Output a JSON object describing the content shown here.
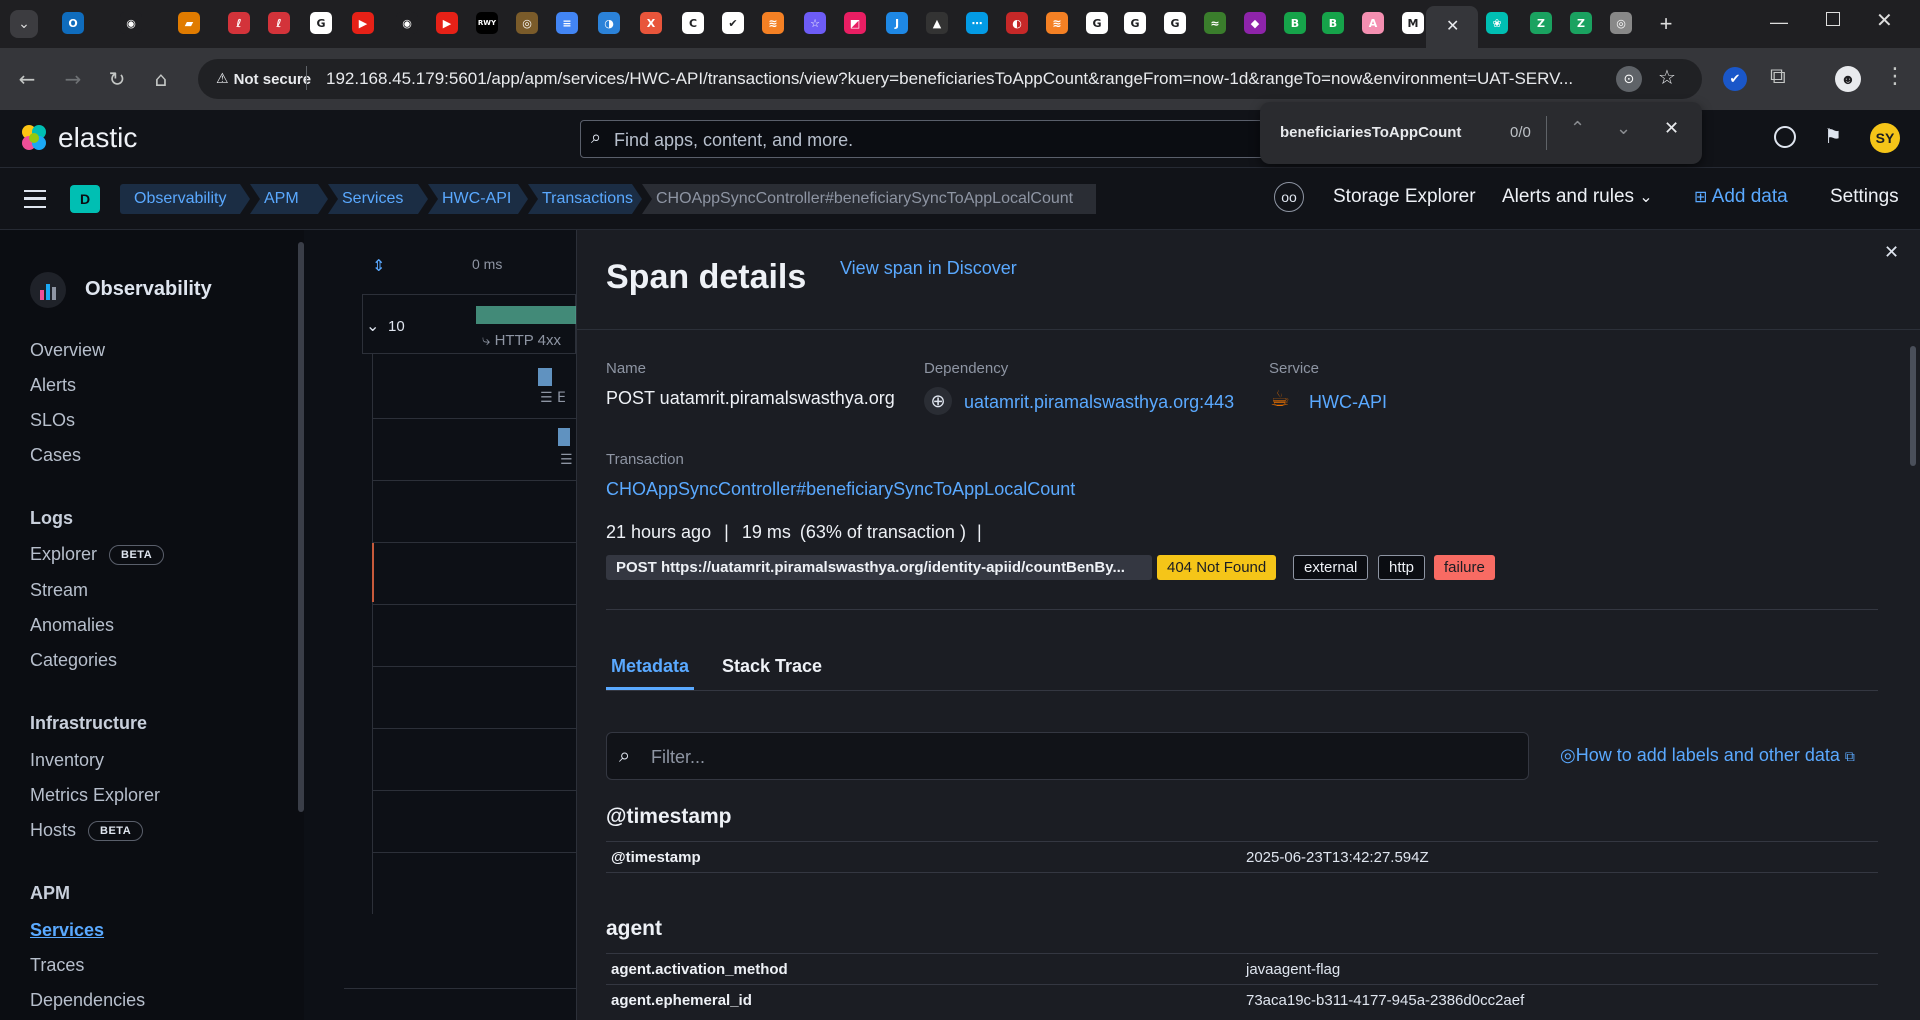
{
  "browser": {
    "find_bar": {
      "query": "beneficiariesToAppCount",
      "count": "0/0"
    },
    "address": {
      "security_label": "Not secure",
      "url": "192.168.45.179:5601/app/apm/services/HWC-API/transactions/view?kuery=beneficiariesToAppCount&rangeFrom=now-1d&rangeTo=now&environment=UAT-SERV..."
    },
    "tabs": [
      {
        "icon": "outlook-icon",
        "color": "#0f6cbd",
        "glyph": "O"
      },
      {
        "icon": "github-icon",
        "color": "#1f1f22",
        "glyph": "◉"
      },
      {
        "icon": "folder-icon",
        "color": "#e07b00",
        "glyph": "▰"
      },
      {
        "icon": "app-icon",
        "color": "#d3333a",
        "glyph": "ℓ"
      },
      {
        "icon": "app-icon",
        "color": "#d3333a",
        "glyph": "ℓ"
      },
      {
        "icon": "google-icon",
        "color": "#ffffff",
        "glyph": "G"
      },
      {
        "icon": "youtube-icon",
        "color": "#e62117",
        "glyph": "▶"
      },
      {
        "icon": "github-icon",
        "color": "#1f1f22",
        "glyph": "◉"
      },
      {
        "icon": "youtube-icon",
        "color": "#e62117",
        "glyph": "▶"
      },
      {
        "icon": "rwy-icon",
        "color": "#000000",
        "glyph": "RWY"
      },
      {
        "icon": "app-icon",
        "color": "#7a5b2a",
        "glyph": "◎"
      },
      {
        "icon": "docs-icon",
        "color": "#4285f4",
        "glyph": "≡"
      },
      {
        "icon": "app-icon",
        "color": "#2b82d9",
        "glyph": "◑"
      },
      {
        "icon": "app-icon",
        "color": "#e8553b",
        "glyph": "X"
      },
      {
        "icon": "app-icon",
        "color": "#ffffff",
        "glyph": "C"
      },
      {
        "icon": "app-icon",
        "color": "#ffffff",
        "glyph": "✔"
      },
      {
        "icon": "stackoverflow-icon",
        "color": "#f48024",
        "glyph": "≋"
      },
      {
        "icon": "app-icon",
        "color": "#6d5cf6",
        "glyph": "☆"
      },
      {
        "icon": "app-icon",
        "color": "#e91e63",
        "glyph": "◩"
      },
      {
        "icon": "app-icon",
        "color": "#1e88e5",
        "glyph": "J"
      },
      {
        "icon": "app-icon",
        "color": "#333333",
        "glyph": "▲"
      },
      {
        "icon": "app-icon",
        "color": "#039be5",
        "glyph": "⋯"
      },
      {
        "icon": "app-icon",
        "color": "#c62828",
        "glyph": "◐"
      },
      {
        "icon": "stackoverflow-icon",
        "color": "#f48024",
        "glyph": "≋"
      },
      {
        "icon": "google-icon",
        "color": "#ffffff",
        "glyph": "G"
      },
      {
        "icon": "google-icon",
        "color": "#ffffff",
        "glyph": "G"
      },
      {
        "icon": "google-icon",
        "color": "#ffffff",
        "glyph": "G"
      },
      {
        "icon": "app-icon",
        "color": "#3a7d2c",
        "glyph": "≈"
      },
      {
        "icon": "app-icon",
        "color": "#8e24aa",
        "glyph": "◆"
      },
      {
        "icon": "app-icon",
        "color": "#16a34a",
        "glyph": "B"
      },
      {
        "icon": "app-icon",
        "color": "#16a34a",
        "glyph": "B"
      },
      {
        "icon": "app-icon",
        "color": "#f48fb1",
        "glyph": "A"
      },
      {
        "icon": "app-icon",
        "color": "#ffffff",
        "glyph": "M"
      },
      {
        "icon": "active-tab",
        "color": "#35363a",
        "glyph": "✕"
      },
      {
        "icon": "elastic-icon",
        "color": "#00bfb3",
        "glyph": "❀"
      },
      {
        "icon": "app-icon",
        "color": "#1aa260",
        "glyph": "Z"
      },
      {
        "icon": "app-icon",
        "color": "#1aa260",
        "glyph": "Z"
      },
      {
        "icon": "chrome-icon",
        "color": "#888888",
        "glyph": "◎"
      }
    ]
  },
  "elastic": {
    "brand": "elastic",
    "search_placeholder": "Find apps, content, and more.",
    "avatar": "SY",
    "space_badge": "D",
    "breadcrumbs": [
      "Observability",
      "APM",
      "Services",
      "HWC-API",
      "Transactions",
      "CHOAppSyncController#beneficiarySyncToAppLocalCount"
    ],
    "header_links": {
      "storage": "Storage Explorer",
      "alerts": "Alerts and rules",
      "add_data": "Add data",
      "settings": "Settings"
    }
  },
  "sidebar": {
    "title": "Observability",
    "top_items": [
      "Overview",
      "Alerts",
      "SLOs",
      "Cases"
    ],
    "logs": {
      "title": "Logs",
      "items": [
        {
          "label": "Explorer",
          "badge": "BETA"
        },
        {
          "label": "Stream"
        },
        {
          "label": "Anomalies"
        },
        {
          "label": "Categories"
        }
      ]
    },
    "infra": {
      "title": "Infrastructure",
      "items": [
        {
          "label": "Inventory"
        },
        {
          "label": "Metrics Explorer"
        },
        {
          "label": "Hosts",
          "badge": "BETA"
        }
      ]
    },
    "apm": {
      "title": "APM",
      "items": [
        "Services",
        "Traces",
        "Dependencies"
      ]
    }
  },
  "waterfall": {
    "axis_start": "0 ms",
    "group_count": "10",
    "span_label": "HTTP 4xx",
    "db_label": "E"
  },
  "span": {
    "title": "Span details",
    "discover_link": "View span in Discover",
    "name_label": "Name",
    "name": "POST uatamrit.piramalswasthya.org",
    "dependency_label": "Dependency",
    "dependency": "uatamrit.piramalswasthya.org:443",
    "service_label": "Service",
    "service": "HWC-API",
    "transaction_label": "Transaction",
    "transaction": "CHOAppSyncController#beneficiarySyncToAppLocalCount",
    "time_ago": "21 hours ago",
    "duration": "19 ms",
    "pct": "(63% of transaction )",
    "url_badge": "POST https://uatamrit.piramalswasthya.org/identity-apiid/countBenBy...",
    "status_badge": "404 Not Found",
    "badges": [
      "external",
      "http",
      "failure"
    ],
    "tabs": {
      "metadata": "Metadata",
      "stack": "Stack Trace"
    },
    "filter_placeholder": "Filter...",
    "help_link": "How to add labels and other data",
    "sections": [
      {
        "title": "@timestamp",
        "rows": [
          {
            "k": "@timestamp",
            "v": "2025-06-23T13:42:27.594Z"
          }
        ]
      },
      {
        "title": "agent",
        "rows": [
          {
            "k": "agent.activation_method",
            "v": "javaagent-flag"
          },
          {
            "k": "agent.ephemeral_id",
            "v": "73aca19c-b311-4177-945a-2386d0cc2aef"
          }
        ]
      }
    ]
  },
  "colors": {
    "accent": "#5aa9ff",
    "warning": "#f5c518",
    "danger": "#f86b63",
    "teal": "#00bfb3"
  }
}
